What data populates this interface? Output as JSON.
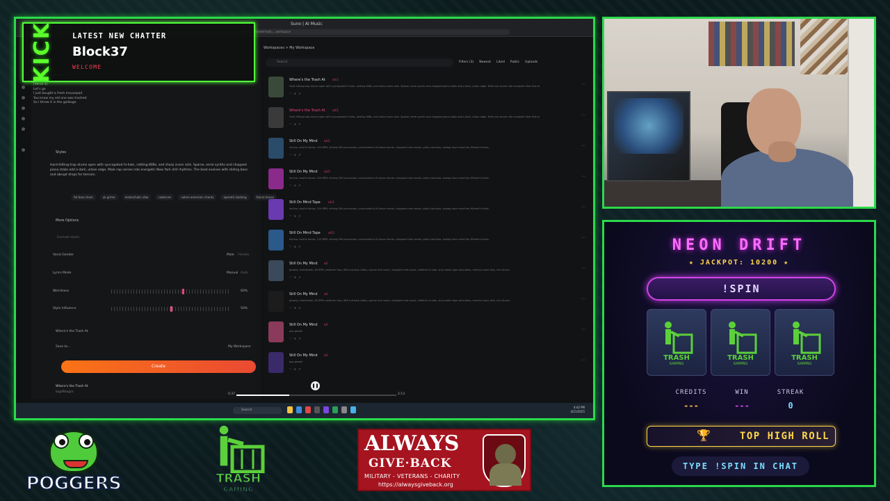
{
  "chatter": {
    "platform": "KICK",
    "label": "LATEST NEW CHATTER",
    "name": "Block37",
    "welcome": "WELCOME"
  },
  "browser": {
    "tab_title": "Suno | AI Music",
    "url": "suno.com/create?wid=...workspace"
  },
  "app": {
    "breadcrumb": "Workspaces  >  My Workspace",
    "lyrics": "Gaming\nYou should try\nTaking out the trash\n\n[Verse 1]\nLet's go\nI just bought a fresh mousepad\nYou know my old one was trashed\nSo I threw it in the garbage",
    "styles_label": "Styles",
    "style_prompt": "Hard-hitting trap drums open with syncopated hi-hats, rattling 808s, and sharp snare rolls. Sparse, eerie synths and chopped piano stabs add a dark, urban edge. Male rap verses ride energetic New York drill rhythms. The beat evolves with sliding bass and abrupt drops for tension.",
    "chips": [
      "fat bass drum",
      "uk grime",
      "melancholic vibe",
      "cadences",
      "native american chants",
      "operatic barbing",
      "future house"
    ],
    "more_options": "More Options",
    "exclude_placeholder": "Exclude styles",
    "vocal_gender": "Vocal Gender",
    "vocal_male": "Male",
    "vocal_female": "Female",
    "lyrics_mode": "Lyrics Mode",
    "lyrics_manual": "Manual",
    "lyrics_auto": "Auto",
    "weirdness": "Weirdness",
    "weirdness_val": "60%",
    "weirdness_level": 0.6,
    "style_influence": "Style Influence",
    "style_influence_val": "50%",
    "style_influence_level": 0.5,
    "song_title": "Where's the Trash At",
    "save_to": "Save to...",
    "save_dest": "My Workspace",
    "create": "Create",
    "search_placeholder": "Search",
    "filters": [
      "Filters (3)",
      "Newest",
      "Liked",
      "Public",
      "Uploads"
    ]
  },
  "songs": [
    {
      "title": "Where's the Trash At",
      "badge": "v4.5",
      "desc": "Hard-hitting trap drums open with syncopated hi-hats, rattling 808s, and sharp snare rolls. Sparse, eerie synths and chopped piano stabs add a dark, urban edge. Male rap verses ride energetic New York drill rhythms.",
      "active": false,
      "color": "#3a4a3a",
      "duration": "2:42"
    },
    {
      "title": "Where's the Trash At",
      "badge": "v4.5",
      "desc": "Hard-hitting trap drums open with syncopated hi-hats, rattling 808s, and sharp snare rolls. Sparse, eerie synths and chopped piano stabs add a dark, urban edge. Male rap verses ride energetic New York drill rhythms.",
      "active": true,
      "color": "#3a3a3a",
      "duration": "2:13"
    },
    {
      "title": "Still On My Mind",
      "badge": "v4.5",
      "desc": "techno, soulful house, 124 BPM, driving 909 percussion, punctuated lo-fi piano chords, chopped male vocals, gritty sub bass, analog drum machine, filtered hi-hats.",
      "active": false,
      "color": "#2a4b6a",
      "duration": "4:18"
    },
    {
      "title": "Still On My Mind",
      "badge": "v4.5",
      "desc": "techno, soulful house, 124 BPM, driving 909 percussion, punctuated lo-fi piano chords, chopped male vocals, gritty sub bass, analog drum machine, filtered hi-hats.",
      "active": false,
      "color": "#8a2a8a",
      "duration": "4:18"
    },
    {
      "title": "Still On Mind Tape",
      "badge": "v4.5",
      "desc": "techno, soulful house, 124 BPM, driving 909 percussion, punctuated lo-fi piano chords, chopped male vocals, gritty sub bass, analog drum machine, filtered hi-hats.",
      "active": false,
      "color": "#6a3ab0",
      "duration": "3:32"
    },
    {
      "title": "Still On Mind Tape",
      "badge": "v4.5",
      "desc": "techno, soulful house, 124 BPM, driving 909 percussion, punctuated lo-fi piano chords, chopped male vocals, gritty sub bass, analog drum machine, filtered hi-hats.",
      "active": false,
      "color": "#2a5a8a",
      "duration": "4:21"
    },
    {
      "title": "Still On My Mind",
      "badge": "v4",
      "desc": "ghostly, heartbreak, 80 BPM, southern trap, 808 sub bass slides, sparse kick snare, chopped male vocal, halftime hi-hats, vinyl static tape saturation, reverse snare rolls, mix drums.",
      "active": false,
      "color": "#3a4a5a",
      "duration": "3:40"
    },
    {
      "title": "Still On My Mind",
      "badge": "v4",
      "desc": "ghostly, heartbreak, 80 BPM, southern trap, 808 sub bass slides, sparse kick snare, chopped male vocal, halftime hi-hats, vinyl static tape saturation, reverse snare rolls, mix drums.",
      "active": false,
      "color": "#1c1c1c",
      "duration": "2:29"
    },
    {
      "title": "Still On My Mind",
      "badge": "v4",
      "desc": "pop gospel",
      "active": false,
      "color": "#8a3a5a",
      "duration": "2:14"
    },
    {
      "title": "Still On My Mind",
      "badge": "v4",
      "desc": "pop gospel",
      "active": false,
      "color": "#3a2a6a",
      "duration": "3:04"
    }
  ],
  "player": {
    "title": "Where's the Trash At",
    "subtitle": "bigaftkagro",
    "elapsed": "0:37",
    "total": "2:13",
    "progress": 0.33
  },
  "taskbar": {
    "search": "Search",
    "time": "4:42 PM",
    "date": "4/21/2025"
  },
  "slot": {
    "title": "NEON DRIFT",
    "jackpot": "★ JACKPOT: 10200 ★",
    "spin": "!SPIN",
    "reel_icon": "trash-gaming-icon",
    "credits_label": "CREDITS",
    "credits_val": "---",
    "win_label": "WIN",
    "win_val": "---",
    "streak_label": "STREAK",
    "streak_val": "0",
    "high_roll": "TOP HIGH ROLL",
    "type_chat": "TYPE !SPIN IN CHAT"
  },
  "logos": {
    "poggers": "POGGERS",
    "trash_title": "TRASH",
    "trash_sub": "GAMING",
    "agb_title": "ALWAYS",
    "agb_sub": "GIVE·BACK",
    "agb_tag": "MILITARY - VETERANS - CHARITY",
    "agb_url": "https://alwaysgiveback.org"
  },
  "colors": {
    "frame": "#2bd94a",
    "kick_green": "#52ff3a",
    "accent_pink": "#e8467c",
    "neon_magenta": "#ff6cff",
    "gold": "#ffd84a"
  }
}
